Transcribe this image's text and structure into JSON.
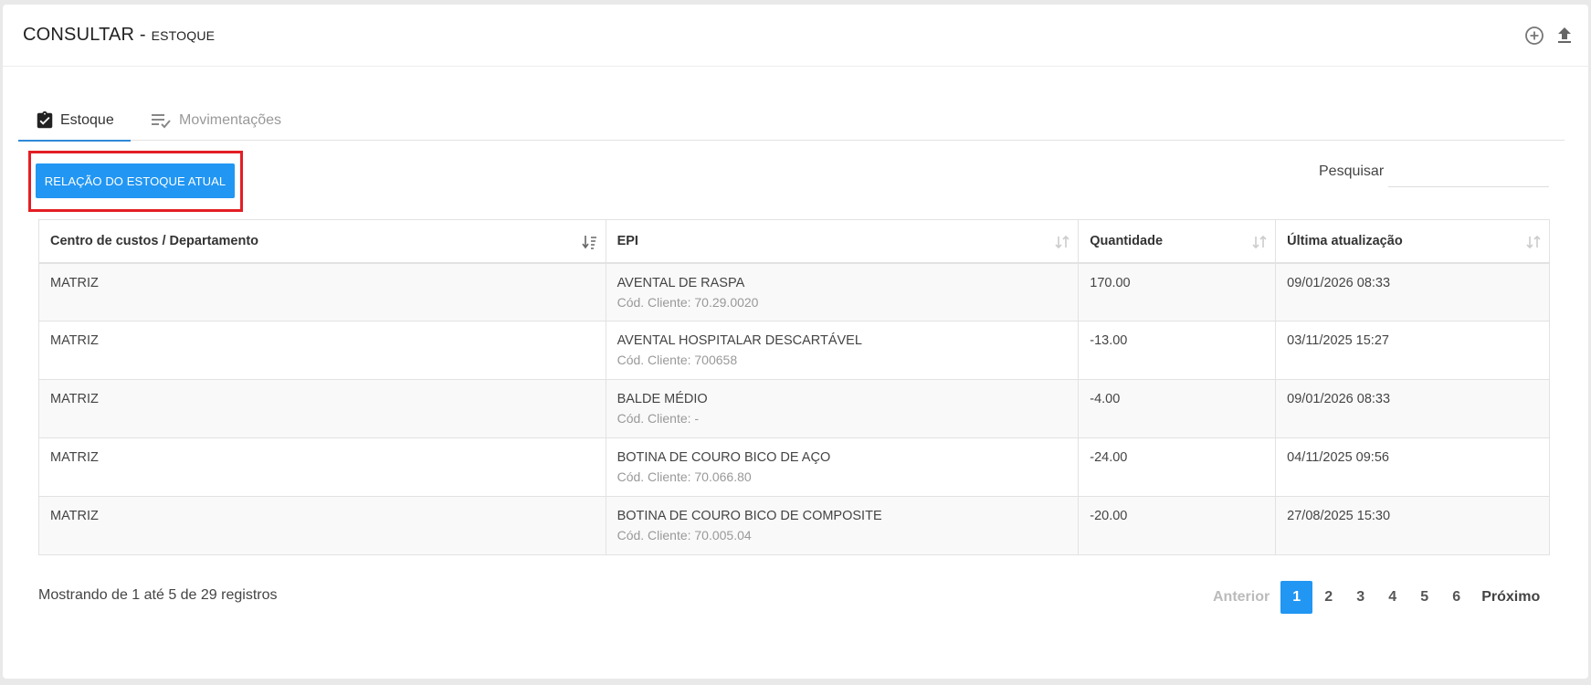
{
  "header": {
    "title": "CONSULTAR -",
    "subtitle": "ESTOQUE",
    "add_icon": "plus-circle-icon",
    "upload_icon": "upload-icon"
  },
  "tabs": [
    {
      "label": "Estoque",
      "icon": "clipboard-check-icon",
      "active": true
    },
    {
      "label": "Movimentações",
      "icon": "list-check-icon",
      "active": false
    }
  ],
  "actions": {
    "report_button": "RELAÇÃO DO ESTOQUE ATUAL"
  },
  "search": {
    "label": "Pesquisar",
    "value": ""
  },
  "table": {
    "columns": [
      "Centro de custos / Departamento",
      "EPI",
      "Quantidade",
      "Última atualização"
    ],
    "rows": [
      {
        "cc": "MATRIZ",
        "epi": "AVENTAL DE RASPA",
        "code": "Cód. Cliente: 70.29.0020",
        "qty": "170.00",
        "updated": "09/01/2026 08:33"
      },
      {
        "cc": "MATRIZ",
        "epi": "AVENTAL HOSPITALAR DESCARTÁVEL",
        "code": "Cód. Cliente: 700658",
        "qty": "-13.00",
        "updated": "03/11/2025 15:27"
      },
      {
        "cc": "MATRIZ",
        "epi": "BALDE MÉDIO",
        "code": "Cód. Cliente: -",
        "qty": "-4.00",
        "updated": "09/01/2026 08:33"
      },
      {
        "cc": "MATRIZ",
        "epi": "BOTINA DE COURO BICO DE AÇO",
        "code": "Cód. Cliente: 70.066.80",
        "qty": "-24.00",
        "updated": "04/11/2025 09:56"
      },
      {
        "cc": "MATRIZ",
        "epi": "BOTINA DE COURO BICO DE COMPOSITE",
        "code": "Cód. Cliente: 70.005.04",
        "qty": "-20.00",
        "updated": "27/08/2025 15:30"
      }
    ]
  },
  "footer": {
    "info": "Mostrando de 1 até 5 de 29 registros",
    "pagination": {
      "prev": "Anterior",
      "pages": [
        "1",
        "2",
        "3",
        "4",
        "5",
        "6"
      ],
      "next": "Próximo"
    }
  },
  "colors": {
    "primary": "#2196f3",
    "highlight": "#e31e24",
    "tab_underline": "#2f8ad8"
  }
}
